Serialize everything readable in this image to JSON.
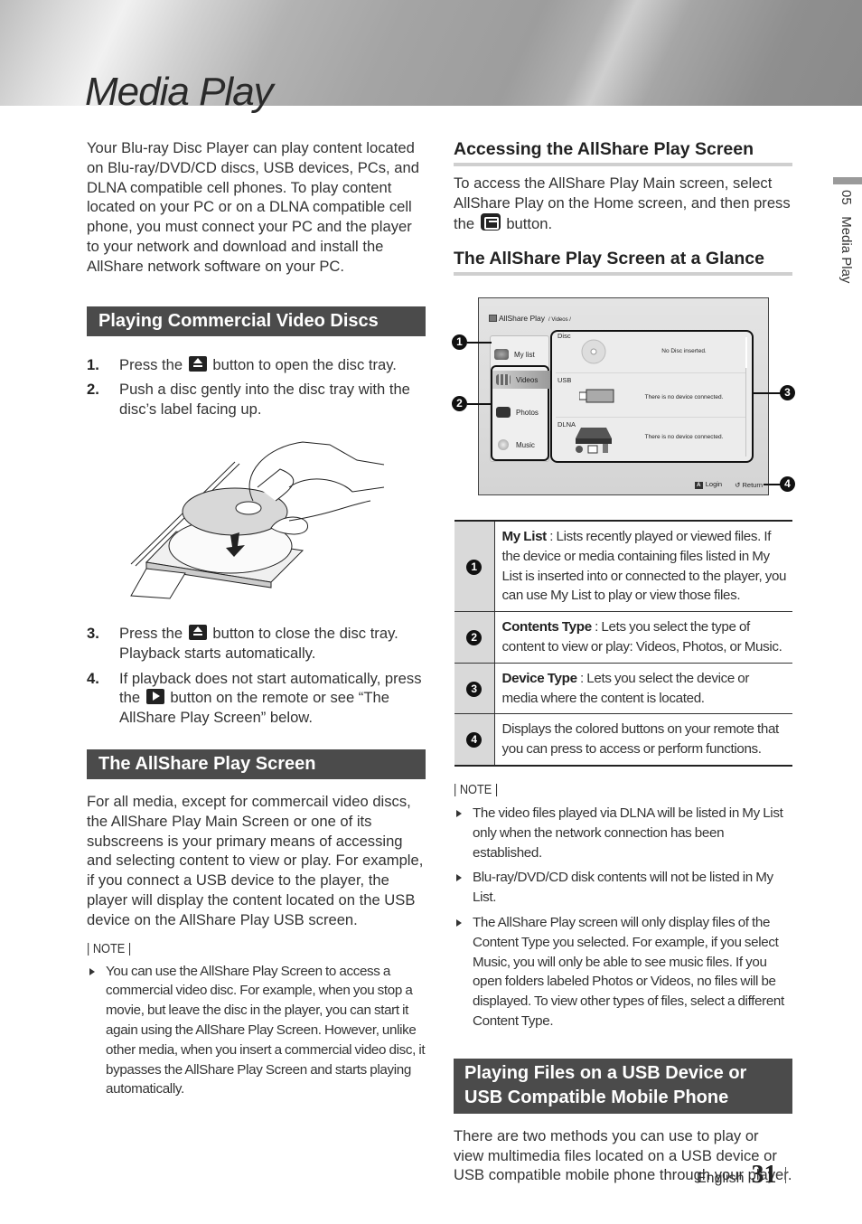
{
  "header": {
    "title": "Media Play"
  },
  "side_tab": {
    "chapter": "05",
    "label": "Media Play"
  },
  "left": {
    "intro": "Your Blu-ray Disc Player can play content located on Blu-ray/DVD/CD discs, USB devices, PCs, and DLNA compatible cell phones. To play content located on your PC or on a DLNA compatible cell phone, you must connect your PC and the player to your network and download and install the AllShare network software on your PC.",
    "section1": {
      "title": "Playing Commercial Video Discs",
      "steps": [
        {
          "num": "1.",
          "before": "Press the",
          "icon": "eject-button-icon",
          "after": "button to open the disc tray."
        },
        {
          "num": "2.",
          "text": "Push a disc gently into the disc tray with the disc’s label facing up."
        },
        {
          "num": "3.",
          "before": "Press the",
          "icon": "eject-button-icon",
          "after": "button to close the disc tray. Playback starts automatically."
        },
        {
          "num": "4.",
          "before": "If playback does not start automatically, press the",
          "icon": "play-button-icon",
          "after": "button on the remote or see “The AllShare Play Screen” below."
        }
      ],
      "illustration": "hand-inserting-disc-into-tray"
    },
    "section2": {
      "title": "The AllShare Play Screen",
      "body": "For all media, except for commercail video discs, the AllShare Play Main Screen or one of its subscreens is your primary means of accessing and selecting content to view or play. For example, if you connect a USB device to the player, the player will display the content located on the USB device on the AllShare Play USB screen.",
      "note_label": "| NOTE |",
      "notes": [
        "You can use the AllShare Play Screen to access a commercial video disc. For example, when you stop a movie, but leave the disc in the player, you can start it again using the AllShare Play Screen. However, unlike other media, when you insert a commercial video disc, it bypasses the AllShare Play Screen and starts playing automatically."
      ]
    }
  },
  "right": {
    "accessing": {
      "title": "Accessing the AllShare Play Screen",
      "before": "To access the AllShare Play Main screen, select AllShare Play on the Home screen, and then press the",
      "icon": "enter-button-icon",
      "after": "button."
    },
    "glance": {
      "title": "The AllShare Play Screen at a Glance"
    },
    "screen": {
      "app_title": "AllShare Play",
      "path": "/ Videos /",
      "menu": [
        "My list",
        "Videos",
        "Photos",
        "Music"
      ],
      "selected": "Videos",
      "devices": [
        {
          "label": "Disc",
          "message": "No Disc inserted."
        },
        {
          "label": "USB",
          "message": "There is no device connected."
        },
        {
          "label": "DLNA",
          "message": "There is no device connected."
        }
      ],
      "footer_buttons": [
        {
          "key": "A",
          "label": "Login"
        },
        {
          "key": "↺",
          "label": "Return"
        }
      ],
      "callouts": [
        "1",
        "2",
        "3",
        "4"
      ]
    },
    "legend": [
      {
        "num": "1",
        "term": "My List",
        "desc": " : Lists recently played or viewed files. If the device or media containing files listed in My List is inserted into or connected to the player, you can use My List to play or view those files."
      },
      {
        "num": "2",
        "term": "Contents Type",
        "desc": " : Lets you select the type of content to view or play: Videos, Photos, or Music."
      },
      {
        "num": "3",
        "term": "Device Type",
        "desc": " : Lets you select the device or media where the content is located."
      },
      {
        "num": "4",
        "term": "",
        "desc": "Displays the colored buttons on your remote that you can press to access or perform functions."
      }
    ],
    "note_label": "| NOTE |",
    "notes": [
      "The video files played via DLNA will be listed in My List only when the network connection has been established.",
      "Blu-ray/DVD/CD disk contents will not be listed in My List.",
      "The AllShare Play screen will only display files of the Content Type you selected. For example, if you select Music, you will only be able to see music files. If you open folders labeled Photos or Videos, no files will be displayed. To view other types of files, select a different Content Type."
    ],
    "section3": {
      "title": "Playing Files on a USB Device or USB Compatible Mobile Phone",
      "body": "There are two methods you can use to play or view multimedia files located on a USB device or USB compatible mobile phone through your player."
    }
  },
  "footer": {
    "language": "English",
    "page": "31"
  }
}
